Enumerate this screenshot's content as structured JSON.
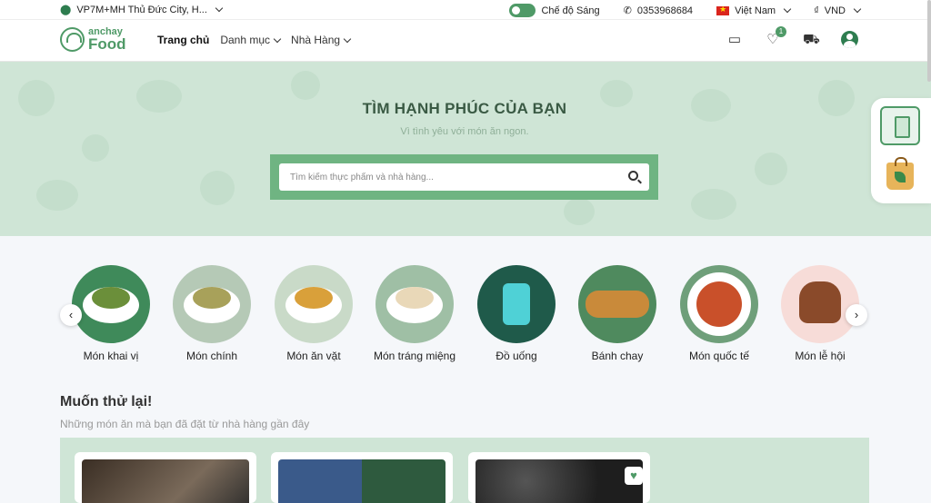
{
  "topbar": {
    "location": "VP7M+MH Thủ Đức City, H...",
    "theme_label": "Chế độ Sáng",
    "phone": "0353968684",
    "language": "Việt Nam",
    "currency": "VND",
    "currency_symbol": "₫"
  },
  "nav": {
    "logo_line1": "anchay",
    "logo_line2": "Food",
    "menu": {
      "home": "Trang chủ",
      "categories": "Danh mục",
      "restaurants": "Nhà Hàng"
    },
    "wishlist_count": "1"
  },
  "hero": {
    "title": "TÌM HẠNH PHÚC CỦA BẠN",
    "subtitle": "Vì tình yêu với món ăn ngon.",
    "search_placeholder": "Tìm kiếm thực phẩm và nhà hàng..."
  },
  "categories": [
    {
      "label": "Món khai vị",
      "bg": "#3f8a5a",
      "food": "#6b8f3a"
    },
    {
      "label": "Món chính",
      "bg": "#b5c9b6",
      "food": "#a8a15a"
    },
    {
      "label": "Món ăn vặt",
      "bg": "#c9dac8",
      "food": "#d9a03a"
    },
    {
      "label": "Món tráng miệng",
      "bg": "#9fbfa5",
      "food": "#e9d8b8"
    },
    {
      "label": "Đồ uống",
      "bg": "#1f5a4a",
      "food": "#4fd1d6"
    },
    {
      "label": "Bánh chay",
      "bg": "#4f8a5e",
      "food": "#c98a3a"
    },
    {
      "label": "Món quốc tế",
      "bg": "#6f9f7a",
      "food": "#c9502a"
    },
    {
      "label": "Món lễ hội",
      "bg": "#f7dcd8",
      "food": "#8a4a2a"
    }
  ],
  "retry": {
    "title": "Muốn thử lại!",
    "subtitle": "Những món ăn mà bạn đã đặt từ nhà hàng gần đây"
  },
  "cards": [
    {
      "img_color": "#5a4a3a"
    },
    {
      "img_color": "#2a4a3a"
    },
    {
      "img_color": "#1e1e1e"
    }
  ],
  "colors": {
    "brand": "#4f9a67",
    "hero_bg": "#cfe5d6",
    "search_frame": "#6fb482"
  }
}
